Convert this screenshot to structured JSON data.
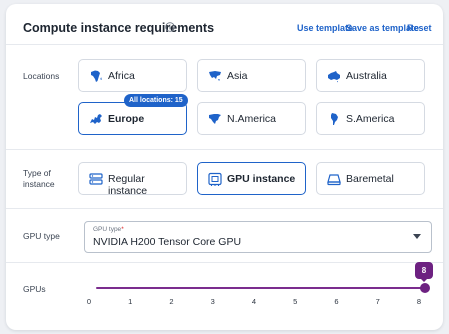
{
  "header": {
    "title": "Compute instance requirements",
    "info_icon": "info-circle-icon",
    "use_template": "Use template",
    "save_as_template": "Save as template",
    "reset": "Reset"
  },
  "locations": {
    "label": "Locations",
    "badge": "All locations: 15",
    "selected": "Europe",
    "items": [
      {
        "label": "Africa",
        "icon": "africa-map-icon"
      },
      {
        "label": "Asia",
        "icon": "asia-map-icon"
      },
      {
        "label": "Australia",
        "icon": "australia-map-icon"
      },
      {
        "label": "Europe",
        "icon": "europe-map-icon"
      },
      {
        "label": "N.America",
        "icon": "north-america-map-icon"
      },
      {
        "label": "S.America",
        "icon": "south-america-map-icon"
      }
    ]
  },
  "instance_type": {
    "label": "Type of instance",
    "selected": "GPU instance",
    "items": [
      {
        "label": "Regular instance",
        "icon": "server-icon"
      },
      {
        "label": "GPU instance",
        "icon": "gpu-chip-icon"
      },
      {
        "label": "Baremetal",
        "icon": "baremetal-icon"
      }
    ]
  },
  "gpu_type": {
    "label": "GPU type",
    "field_label": "GPU type",
    "required_mark": "*",
    "value": "NVIDIA H200 Tensor Core GPU"
  },
  "gpus": {
    "label": "GPUs",
    "value": 8,
    "value_label": "8",
    "min": 0,
    "max": 8,
    "ticks": [
      "0",
      "1",
      "2",
      "3",
      "4",
      "5",
      "6",
      "7",
      "8"
    ]
  },
  "colors": {
    "accent": "#1f63c9",
    "slider": "#6d2181",
    "map_icon": "#1f63c9"
  }
}
